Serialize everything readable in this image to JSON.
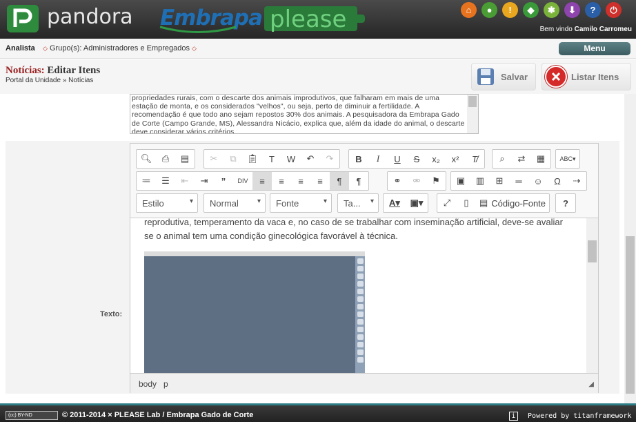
{
  "header": {
    "app_name": "pandora",
    "embrapa_logo": "Embrapa",
    "please_logo": "please",
    "icons": [
      {
        "name": "home-icon",
        "glyph": "⌂",
        "color": "#e8731f"
      },
      {
        "name": "user-icon",
        "glyph": "●",
        "color": "#4a9c34"
      },
      {
        "name": "alert-icon",
        "glyph": "!",
        "color": "#e8a71f"
      },
      {
        "name": "brazil-flag-icon",
        "glyph": "◆",
        "color": "#3a9a3a"
      },
      {
        "name": "uk-flag-icon",
        "glyph": "✱",
        "color": "#7ab23a"
      },
      {
        "name": "download-icon",
        "glyph": "⬇",
        "color": "#8e44ad"
      },
      {
        "name": "help-icon",
        "glyph": "?",
        "color": "#2a5fa8"
      },
      {
        "name": "power-icon",
        "glyph": "⏻",
        "color": "#d0302b"
      }
    ],
    "welcome_prefix": "Bem vindo",
    "user_name": "Camilo Carromeu"
  },
  "userbar": {
    "role": "Analista",
    "groups_label": "Grupo(s):",
    "groups_value": "Administradores e Empregados",
    "menu_label": "Menu"
  },
  "titlebar": {
    "title_accent": "Notícias:",
    "title_rest": "Editar Itens",
    "breadcrumb": "Portal da Unidade » Notícias",
    "save_label": "Salvar",
    "list_label": "Listar Itens"
  },
  "textarea_preview": "propriedades rurais, com o descarte dos animais improdutivos, que falharam em mais de uma estação de monta, e os considerados \"velhos\", ou seja, perto de diminuir a fertilidade. A recomendação é que todo ano sejam repostos 30% dos animais. A pesquisadora da Embrapa Gado de Corte (Campo Grande, MS), Alessandra Nicácio, explica que, além da idade do animal, o descarte deve considerar vários critérios.",
  "field_label": "Texto:",
  "editor": {
    "combos": {
      "style": "Estilo",
      "format": "Normal",
      "font": "Fonte",
      "size": "Ta..."
    },
    "source_label": "Código-Fonte",
    "body_text": "reprodutiva, temperamento da vaca e, no caso de se trabalhar com inseminação artificial, deve-se avaliar se o animal tem uma condição ginecológica favorável à técnica.",
    "status_path": [
      "body",
      "p"
    ]
  },
  "footer": {
    "license": "(cc) BY-ND",
    "copyright": "© 2011-2014 × PLEASE Lab / Embrapa Gado de Corte",
    "info": "i",
    "powered_by": "Powered by titanframework"
  }
}
